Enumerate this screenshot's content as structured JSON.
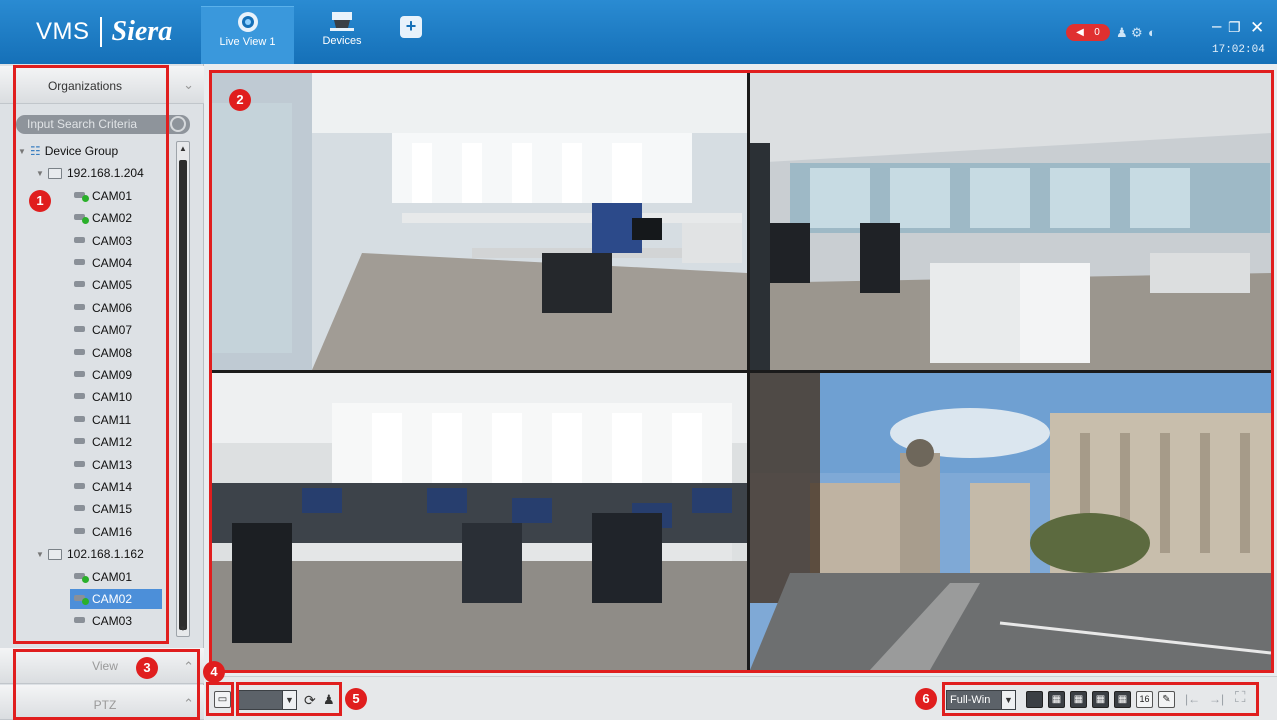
{
  "app": {
    "brand_left": "VMS",
    "brand_right": "Siera",
    "clock": "17:02:04",
    "alarm_count": "0"
  },
  "tabs": [
    {
      "label": "Live View 1",
      "icon": "camera-lens-icon"
    },
    {
      "label": "Devices",
      "icon": "dome-camera-icon"
    }
  ],
  "sidebar": {
    "organizations_label": "Organizations",
    "search_placeholder": "Input Search Criteria",
    "root": "Device Group",
    "groups": [
      {
        "name": "192.168.1.204",
        "cameras": [
          "CAM01",
          "CAM02",
          "CAM03",
          "CAM04",
          "CAM05",
          "CAM06",
          "CAM07",
          "CAM08",
          "CAM09",
          "CAM10",
          "CAM11",
          "CAM12",
          "CAM13",
          "CAM14",
          "CAM15",
          "CAM16"
        ],
        "active": [
          "CAM01",
          "CAM02"
        ]
      },
      {
        "name": "102.168.1.162",
        "cameras": [
          "CAM01",
          "CAM02",
          "CAM03"
        ],
        "active": [
          "CAM01",
          "CAM02"
        ],
        "selected": "CAM02"
      }
    ],
    "view_label": "View",
    "ptz_label": "PTZ"
  },
  "toolbar": {
    "window_mode": "Full-Win",
    "split_16": "16"
  },
  "callouts": [
    "1",
    "2",
    "3",
    "4",
    "5",
    "6"
  ],
  "colors": {
    "titlebar": "#1a7cc4",
    "annotation": "#e01e1e",
    "selection": "#4c8fd9"
  }
}
